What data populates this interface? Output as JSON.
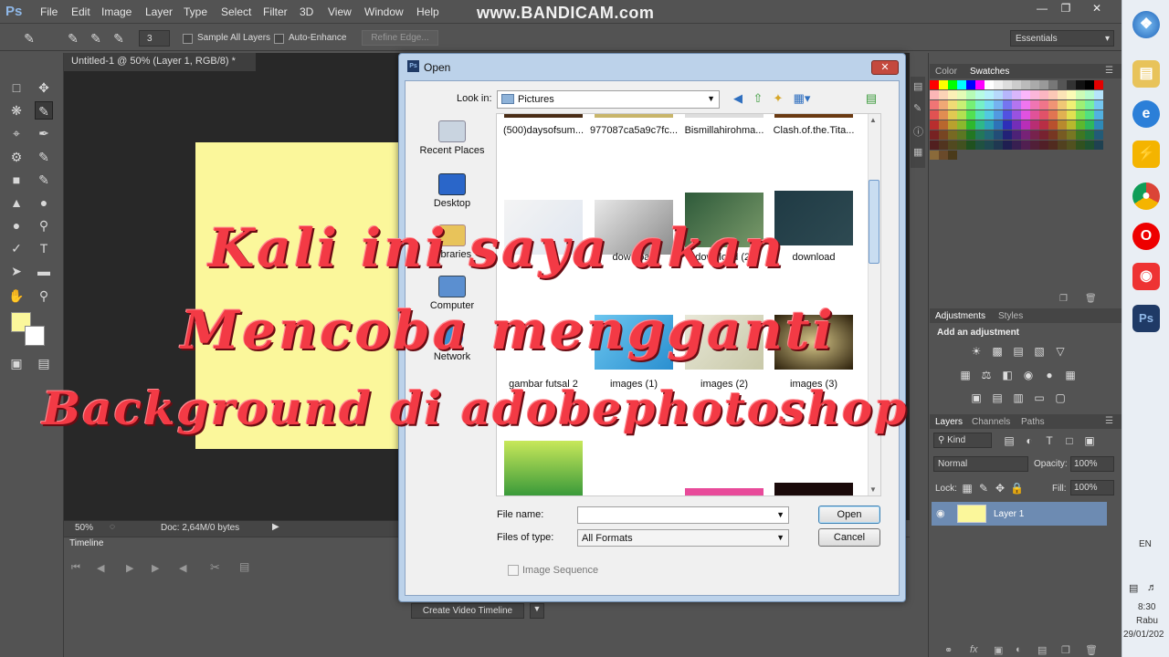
{
  "menubar": {
    "logo": "Ps",
    "items": [
      "File",
      "Edit",
      "Image",
      "Layer",
      "Type",
      "Select",
      "Filter",
      "3D",
      "View",
      "Window",
      "Help"
    ],
    "watermark": "www.BANDICAM.com"
  },
  "options": {
    "brush_size": "3",
    "sample_all_layers": "Sample All Layers",
    "auto_enhance": "Auto-Enhance",
    "refine_edge": "Refine Edge...",
    "workspace": "Essentials"
  },
  "document": {
    "tab_title": "Untitled-1 @ 50% (Layer 1, RGB/8) *",
    "zoom": "50%",
    "doc_info": "Doc: 2,64M/0 bytes",
    "canvas_color": "#fbf79b"
  },
  "timeline": {
    "tab": "Timeline",
    "create_button": "Create Video Timeline"
  },
  "panels": {
    "color_tab": "Color",
    "swatches_tab": "Swatches",
    "adjustments_tab": "Adjustments",
    "styles_tab": "Styles",
    "add_adjustment": "Add an adjustment",
    "layers_tab": "Layers",
    "channels_tab": "Channels",
    "paths_tab": "Paths",
    "kind": "Kind",
    "blend_mode": "Normal",
    "opacity_label": "Opacity:",
    "opacity": "100%",
    "lock_label": "Lock:",
    "fill_label": "Fill:",
    "fill": "100%",
    "layer_name": "Layer 1"
  },
  "dialog": {
    "title": "Open",
    "look_in_label": "Look in:",
    "look_in": "Pictures",
    "places": [
      "Recent Places",
      "Desktop",
      "Libraries",
      "Computer",
      "Network"
    ],
    "files": [
      "(500)daysofsum...",
      "977087ca5a9c7fc...",
      "Bismillahirohma...",
      "Clash.of.the.Tita...",
      "",
      "download",
      "download (2)",
      "download",
      "gambar futsal 2",
      "images (1)",
      "images (2)",
      "images (3)"
    ],
    "file_name_label": "File name:",
    "file_name": "",
    "files_of_type_label": "Files of type:",
    "files_of_type": "All Formats",
    "open_button": "Open",
    "cancel_button": "Cancel",
    "image_sequence": "Image Sequence"
  },
  "caption": {
    "line1": "Kali ini saya akan",
    "line2": "Mencoba mengganti",
    "line3": "Background di adobephotoshop"
  },
  "taskbar": {
    "language": "EN",
    "time": "8:30",
    "day": "Rabu",
    "date": "29/01/202"
  }
}
